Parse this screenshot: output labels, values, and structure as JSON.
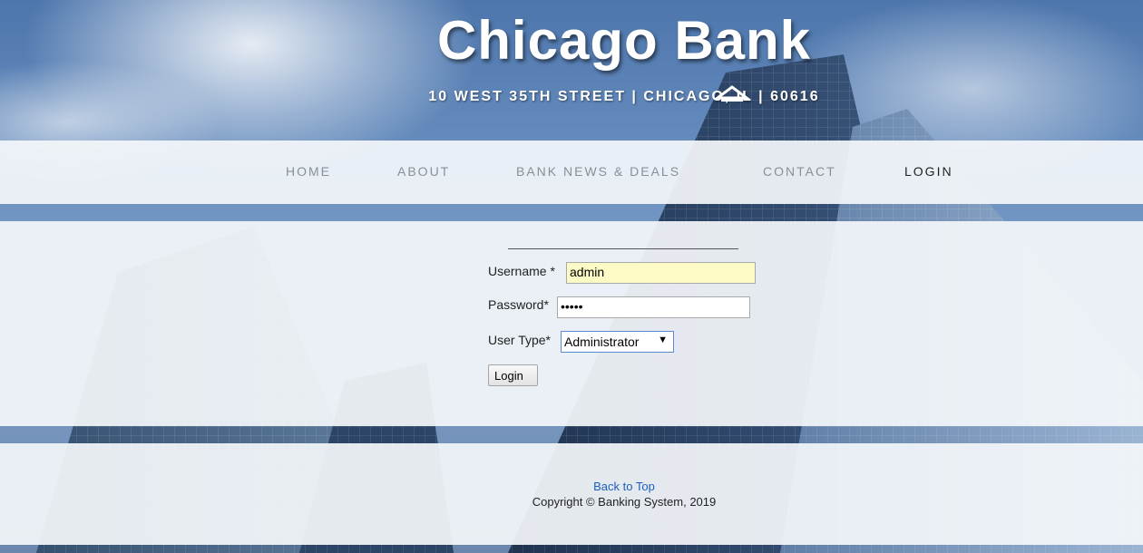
{
  "header": {
    "title": "Chicago Bank",
    "address": "10 WEST 35TH STREET | CHICAGO, IL | 60616"
  },
  "nav": {
    "items": [
      {
        "label": "HOME",
        "active": false
      },
      {
        "label": "ABOUT",
        "active": false
      },
      {
        "label": "BANK NEWS & DEALS",
        "active": false
      },
      {
        "label": "CONTACT",
        "active": false
      },
      {
        "label": "LOGIN",
        "active": true
      }
    ]
  },
  "login": {
    "username_label": "Username *",
    "username_value": "admin",
    "password_label": "Password*",
    "password_value": "•••••",
    "usertype_label": "User Type*",
    "usertype_value": "Administrator",
    "submit_label": "Login"
  },
  "footer": {
    "back_to_top": "Back to Top",
    "copyright": "Copyright © Banking System, 2019"
  },
  "colors": {
    "link": "#1a5fbf",
    "active_nav": "#222222",
    "nav": "#8a8f96"
  }
}
